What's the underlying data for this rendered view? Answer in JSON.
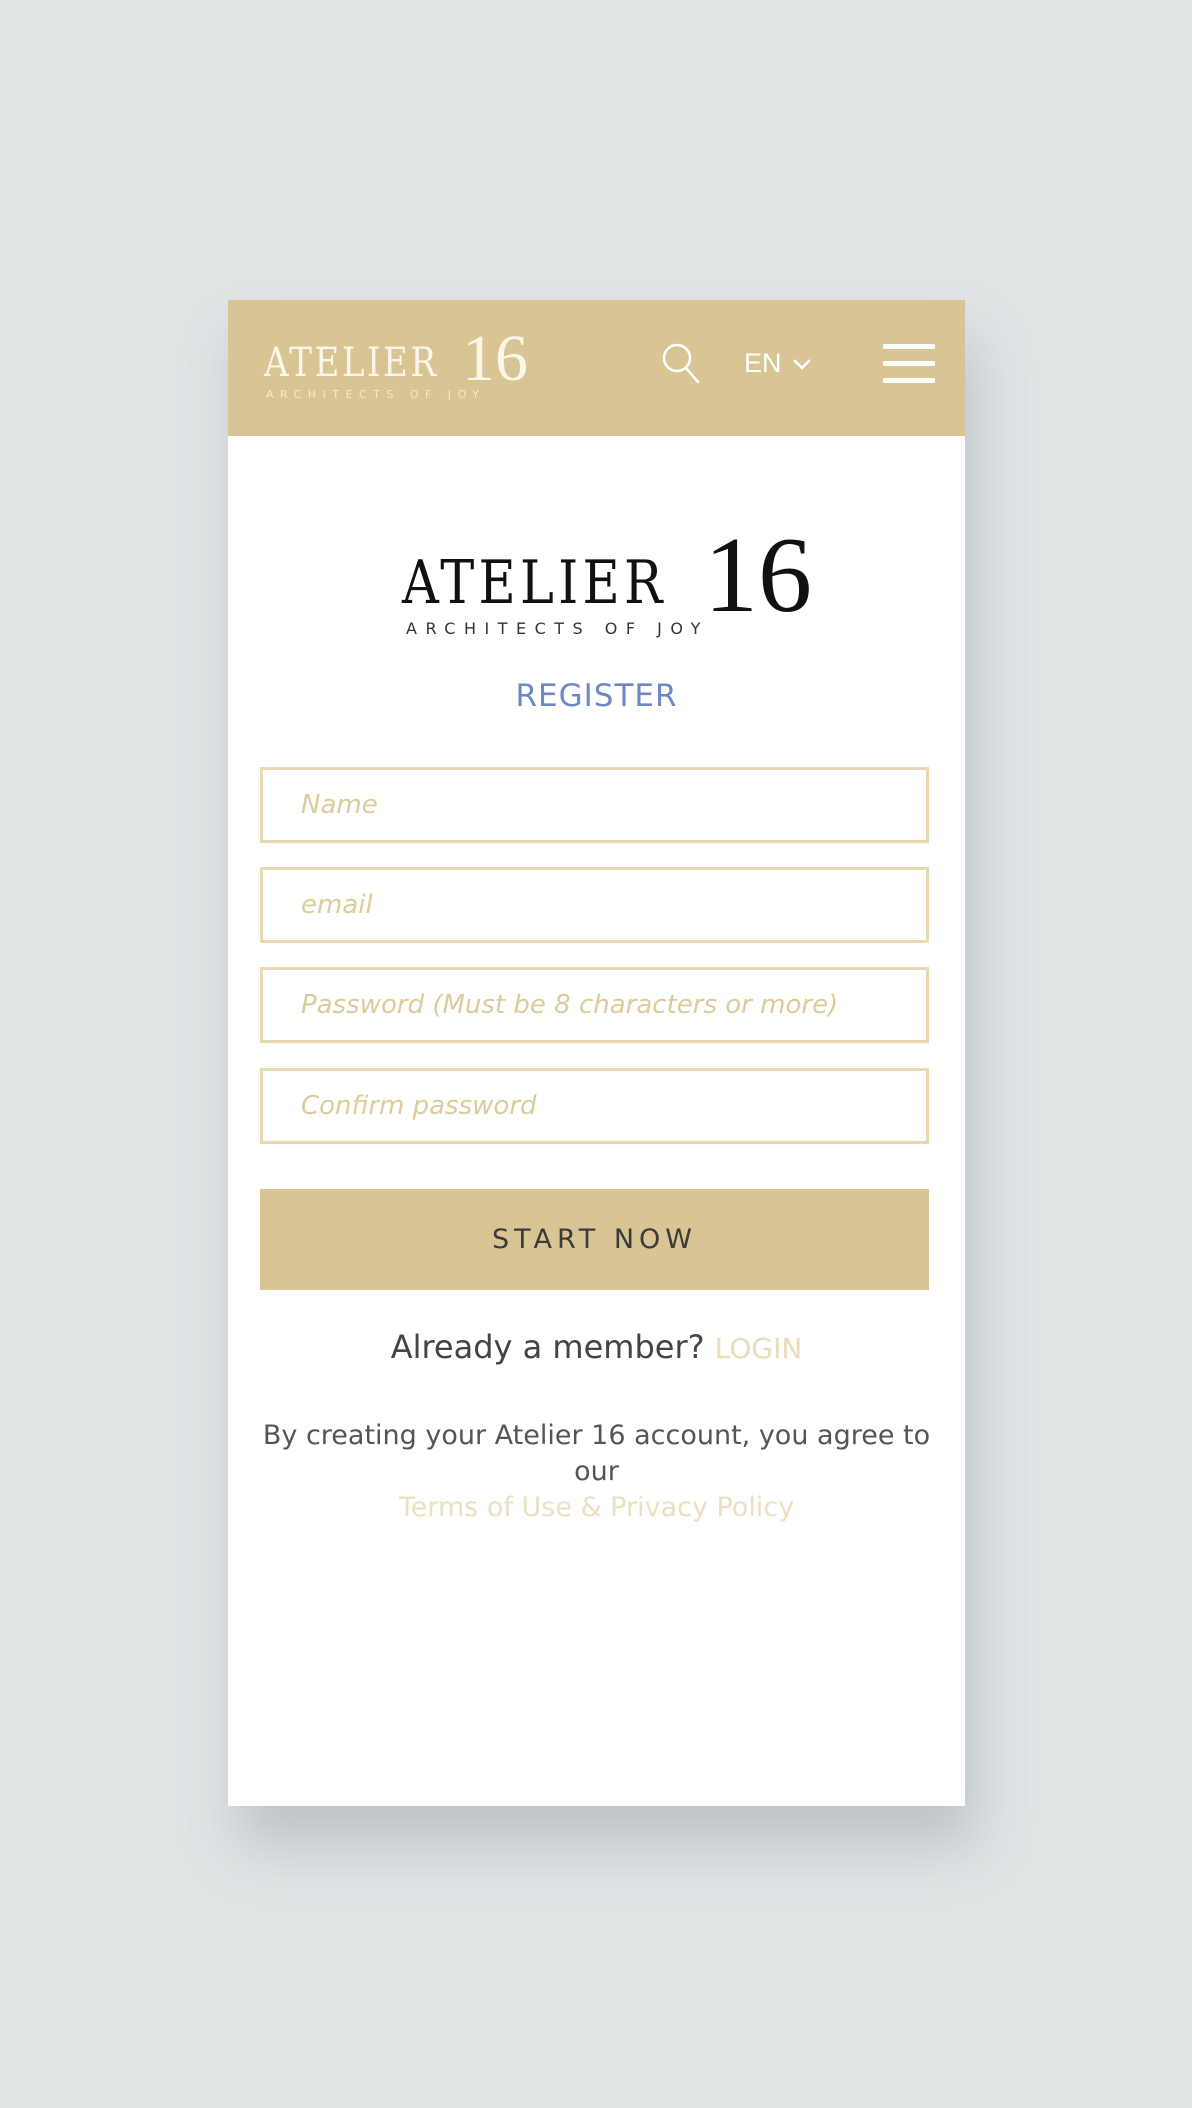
{
  "header": {
    "logo": {
      "word": "ATELIER",
      "number": "16",
      "tagline": "ARCHITECTS OF JOY"
    },
    "search_icon": "search-icon",
    "language": "EN",
    "language_icon": "chevron-down-icon",
    "menu_icon": "hamburger-menu-icon"
  },
  "brand_logo": {
    "word": "ATELIER",
    "number": "16",
    "tagline": "ARCHITECTS OF JOY"
  },
  "form": {
    "title": "REGISTER",
    "fields": [
      {
        "name": "name",
        "placeholder": "Name",
        "value": ""
      },
      {
        "name": "email",
        "placeholder": "email",
        "value": ""
      },
      {
        "name": "password",
        "placeholder": "Password (Must be 8 characters or more)",
        "value": ""
      },
      {
        "name": "confirm_password",
        "placeholder": "Confirm password",
        "value": ""
      }
    ],
    "submit_label": "START NOW"
  },
  "login_prompt": {
    "text": "Already a member?",
    "link": "LOGIN"
  },
  "agreement": {
    "text": "By creating your Atelier 16 account, you agree to our",
    "link": "Terms of Use & Privacy Policy"
  },
  "colors": {
    "brand_gold": "#d9c594",
    "register_blue": "#6f87c4",
    "background": "#e0e4e5"
  }
}
